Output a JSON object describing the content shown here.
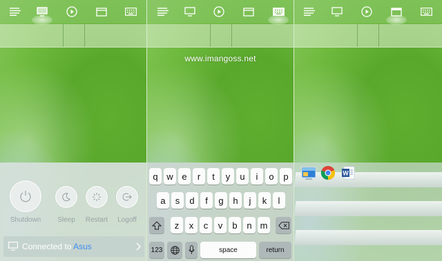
{
  "toolbar": {
    "icons": [
      "menu-icon",
      "monitor-icon",
      "play-icon",
      "window-icon",
      "keyboard-icon"
    ]
  },
  "watermark": "www.imangoss.net",
  "power": {
    "shutdown_label": "Shutdown",
    "sleep_label": "Sleep",
    "restart_label": "Restart",
    "logoff_label": "Logoff"
  },
  "connection": {
    "prefix": "Connected to ",
    "device": "Asus"
  },
  "keyboard": {
    "row1": [
      "q",
      "w",
      "e",
      "r",
      "t",
      "y",
      "u",
      "i",
      "o",
      "p"
    ],
    "row2": [
      "a",
      "s",
      "d",
      "f",
      "g",
      "h",
      "j",
      "k",
      "l"
    ],
    "row3": [
      "z",
      "x",
      "c",
      "v",
      "b",
      "n",
      "m"
    ],
    "numbers_label": "123",
    "space_label": "space",
    "return_label": "return"
  },
  "taskbar_apps": [
    "windows-explorer-icon",
    "chrome-icon",
    "word-icon"
  ],
  "colors": {
    "accent_link": "#3d8ef0",
    "wallpaper_green": "#5fae2f"
  }
}
